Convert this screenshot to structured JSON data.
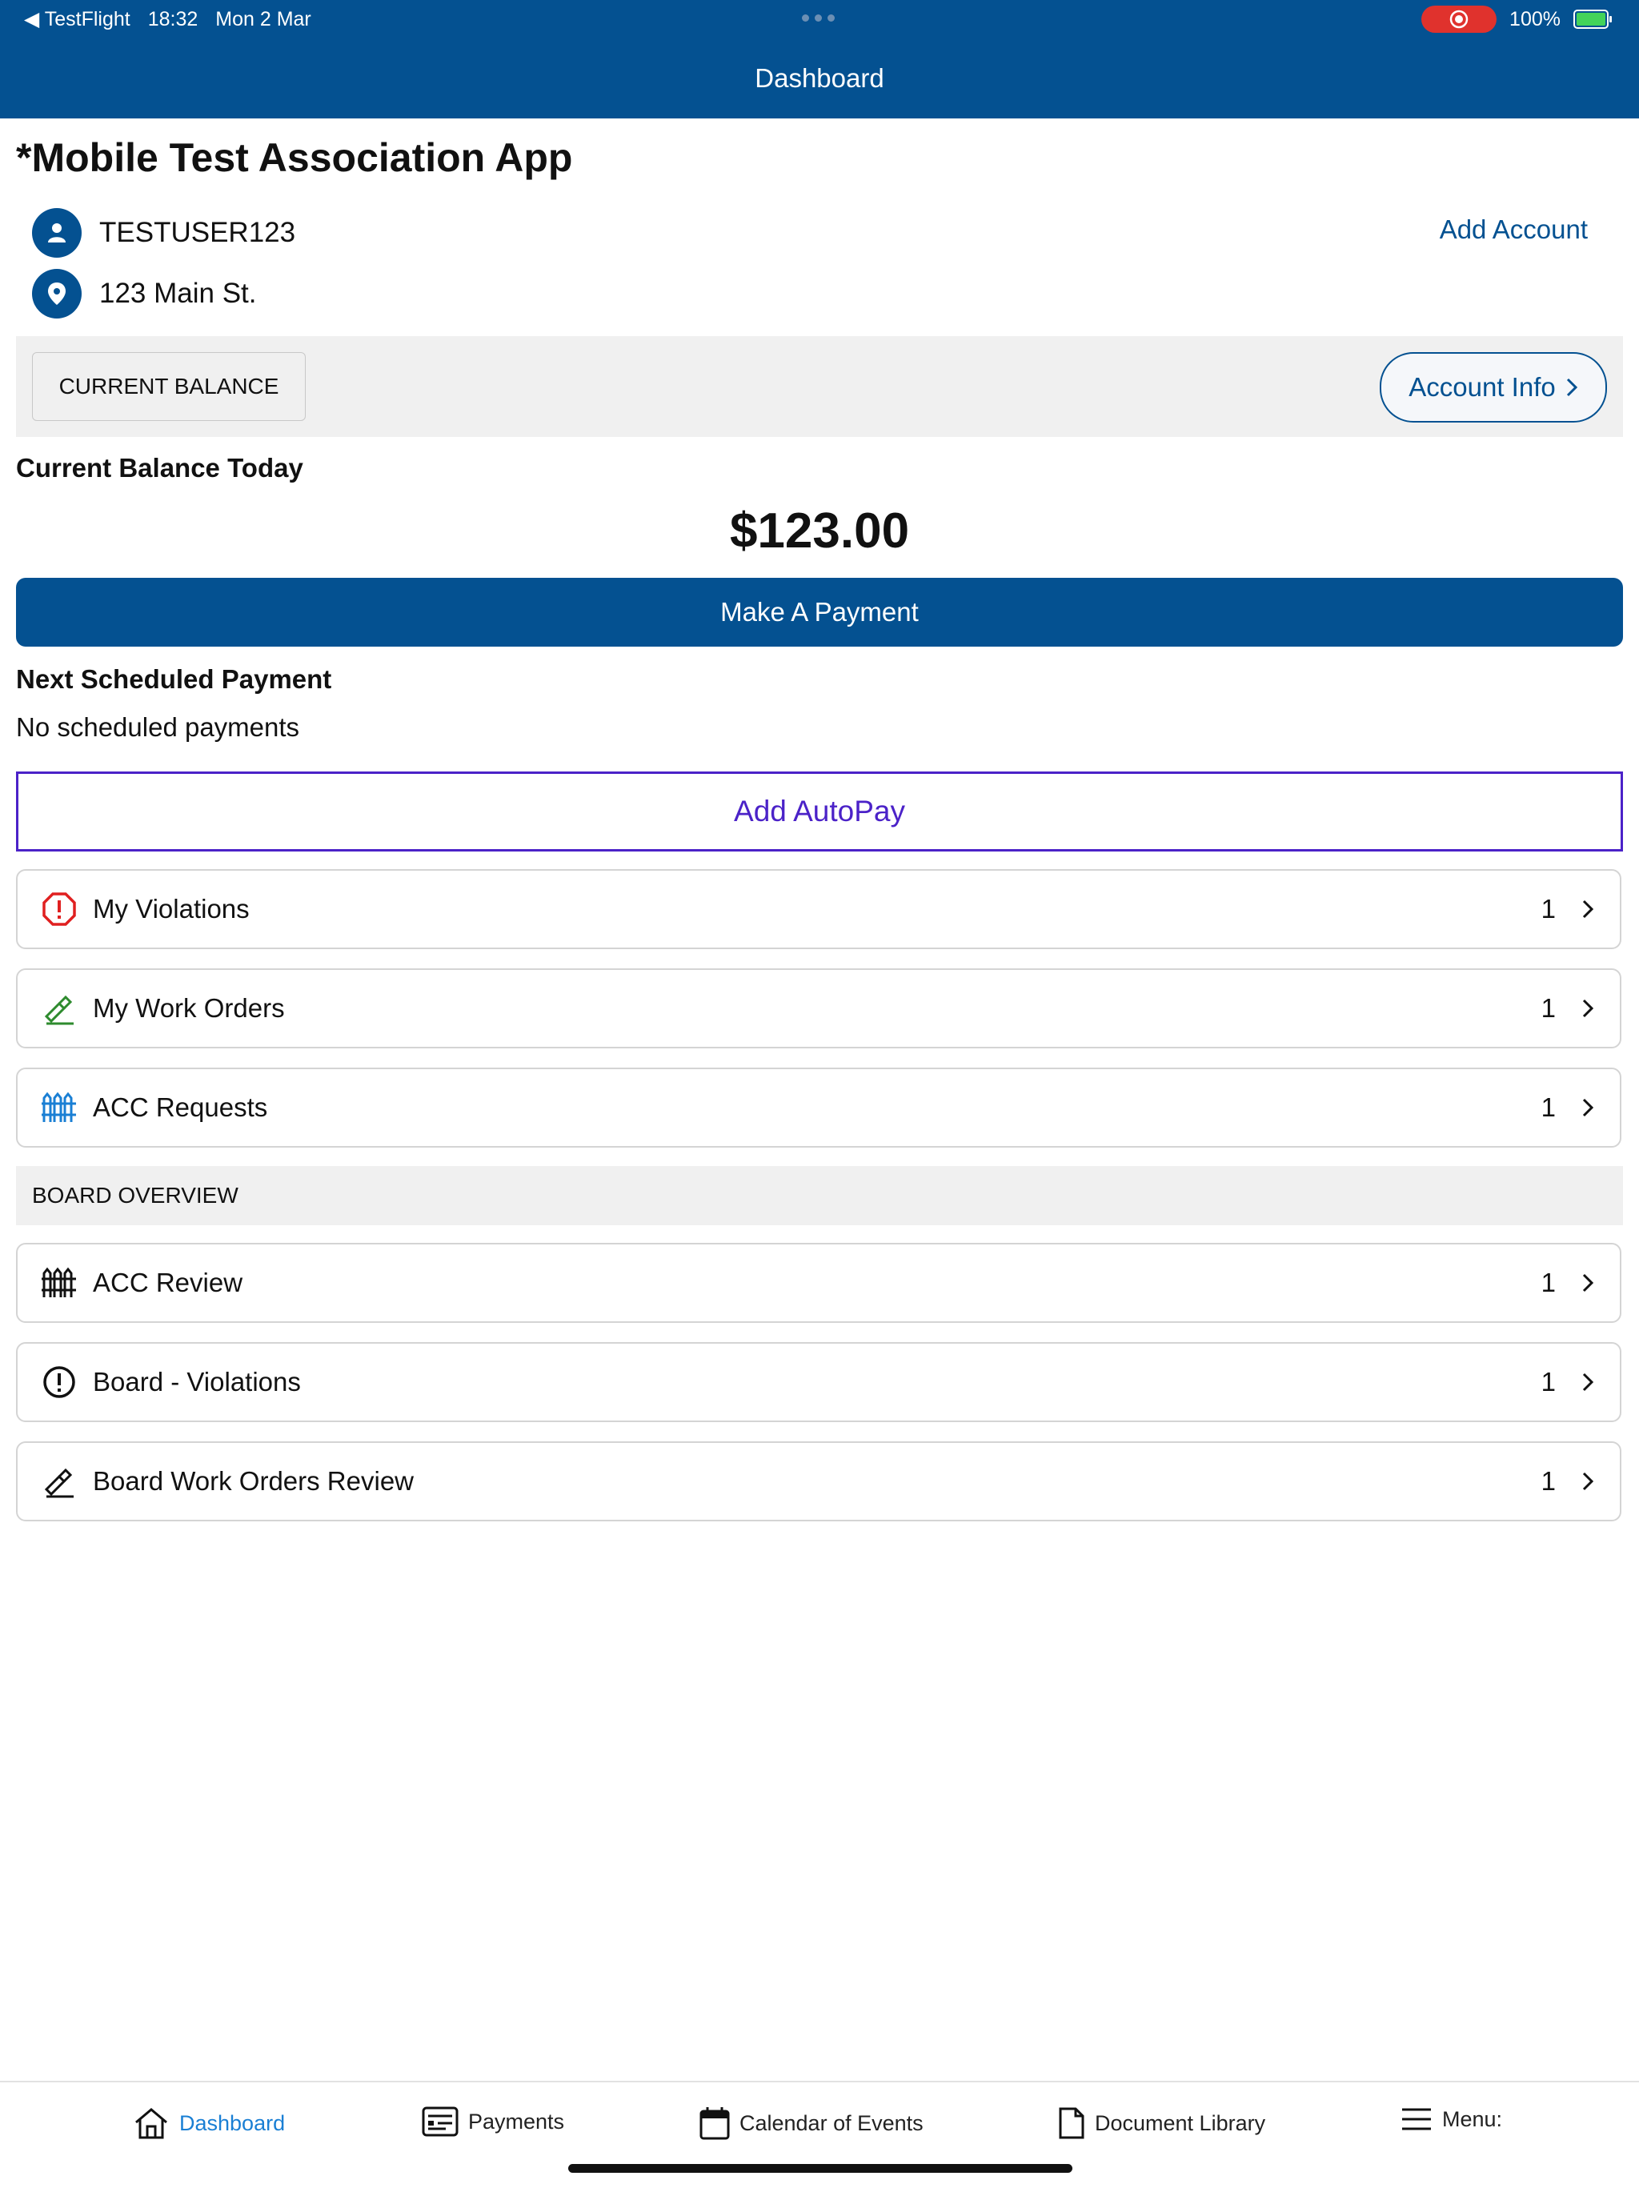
{
  "status_bar": {
    "back_app": "◀ TestFlight",
    "time": "18:32",
    "date": "Mon 2 Mar",
    "battery": "100%"
  },
  "nav": {
    "title": "Dashboard"
  },
  "association": {
    "title": "*Mobile Test Association App",
    "user": "TESTUSER123",
    "address": "123 Main St.",
    "add_account": "Add Account"
  },
  "balance": {
    "tag": "CURRENT BALANCE",
    "account_info": "Account Info",
    "today_label": "Current Balance Today",
    "amount": "$123.00",
    "pay_button": "Make A Payment"
  },
  "schedule": {
    "label": "Next Scheduled Payment",
    "empty": "No scheduled payments",
    "autopay_button": "Add AutoPay"
  },
  "my_items": [
    {
      "label": "My Violations",
      "count": "1",
      "icon": "violation-icon"
    },
    {
      "label": "My Work Orders",
      "count": "1",
      "icon": "work-order-icon"
    },
    {
      "label": "ACC Requests",
      "count": "1",
      "icon": "fence-icon"
    }
  ],
  "board": {
    "header": "BOARD OVERVIEW",
    "items": [
      {
        "label": "ACC Review",
        "count": "1",
        "icon": "fence-icon"
      },
      {
        "label": "Board - Violations",
        "count": "1",
        "icon": "violation-icon"
      },
      {
        "label": "Board Work Orders Review",
        "count": "1",
        "icon": "work-order-icon"
      }
    ]
  },
  "tabs": [
    {
      "label": "Dashboard",
      "icon": "home-icon",
      "active": true
    },
    {
      "label": "Payments",
      "icon": "payments-icon"
    },
    {
      "label": "Calendar of Events",
      "icon": "calendar-icon"
    },
    {
      "label": "Document Library",
      "icon": "document-icon"
    },
    {
      "label": "Menu:",
      "icon": "menu-icon"
    }
  ],
  "colors": {
    "brand": "#045191",
    "autopay": "#4b22c8",
    "violation_red": "#e02020",
    "work_green": "#2e8b2e",
    "acc_blue": "#1a7fd4",
    "tab_active": "#1a7fd4"
  }
}
